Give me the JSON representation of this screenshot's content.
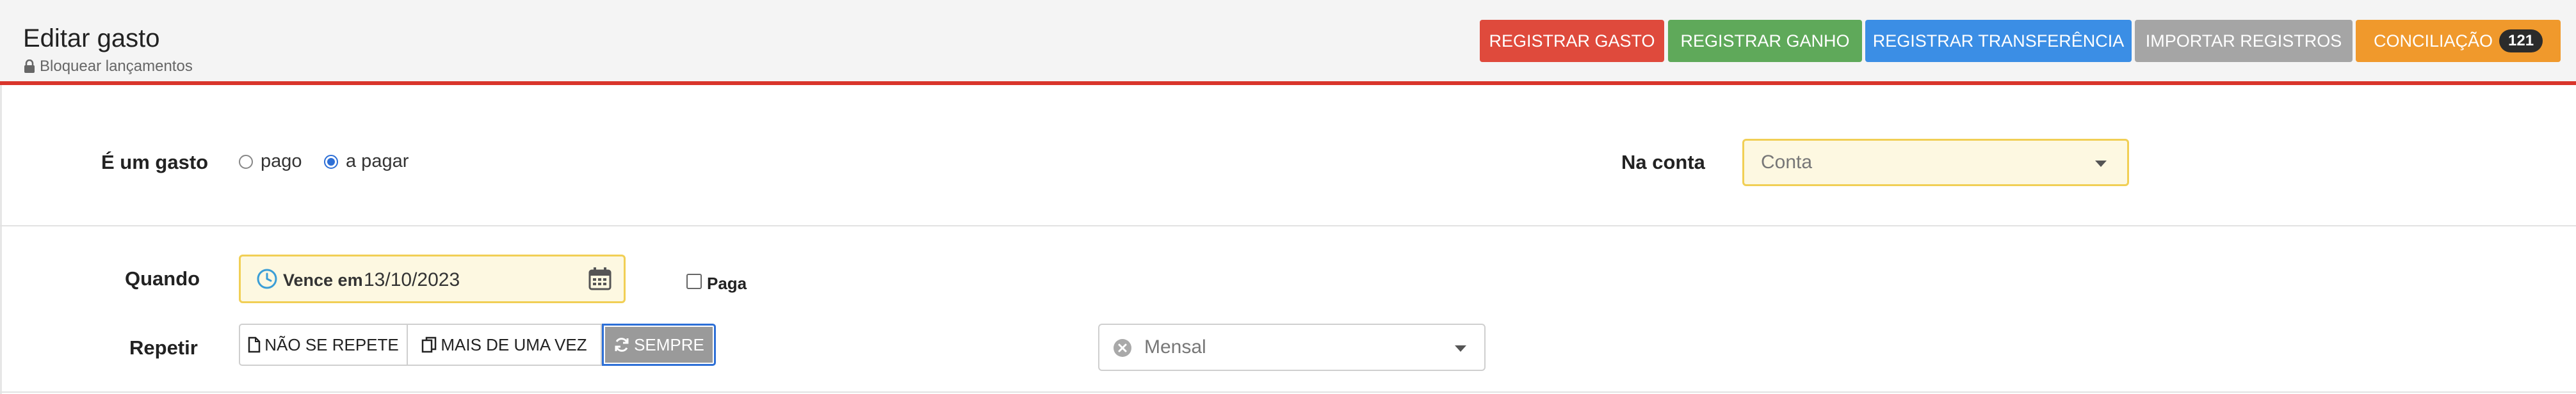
{
  "header": {
    "title": "Editar gasto",
    "lock_label": "Bloquear lançamentos",
    "buttons": {
      "registrar_gasto": "REGISTRAR GASTO",
      "registrar_ganho": "REGISTRAR GANHO",
      "registrar_transferencia": "REGISTRAR TRANSFERÊNCIA",
      "importar_registros": "IMPORTAR REGISTROS",
      "conciliacao": "CONCILIAÇÃO",
      "conciliacao_badge": "121"
    }
  },
  "colors": {
    "gasto": "#df4a3c",
    "ganho": "#5fa95a",
    "transferencia": "#3b8ee5",
    "importar": "#a5a5a5",
    "conciliacao": "#f0992c",
    "header_rule": "#d9352b"
  },
  "form": {
    "tipo": {
      "label": "É um gasto",
      "options": [
        "pago",
        "a pagar"
      ],
      "selected": "a pagar"
    },
    "conta": {
      "label": "Na conta",
      "placeholder": "Conta"
    },
    "quando": {
      "label": "Quando",
      "prefix": "Vence em",
      "date": "13/10/2023",
      "paga_label": "Paga",
      "paga_checked": false
    },
    "repetir": {
      "label": "Repetir",
      "options": [
        "NÃO SE REPETE",
        "MAIS DE UMA VEZ",
        "SEMPRE"
      ],
      "selected": "SEMPRE",
      "frequency": "Mensal"
    }
  },
  "icons": {
    "lock": "lock-icon",
    "clock": "clock-icon",
    "calendar": "calendar-icon",
    "file": "file-icon",
    "copy": "copy-icon",
    "refresh": "refresh-icon",
    "clear": "clear-icon",
    "dropdown": "chevron-down-icon"
  }
}
